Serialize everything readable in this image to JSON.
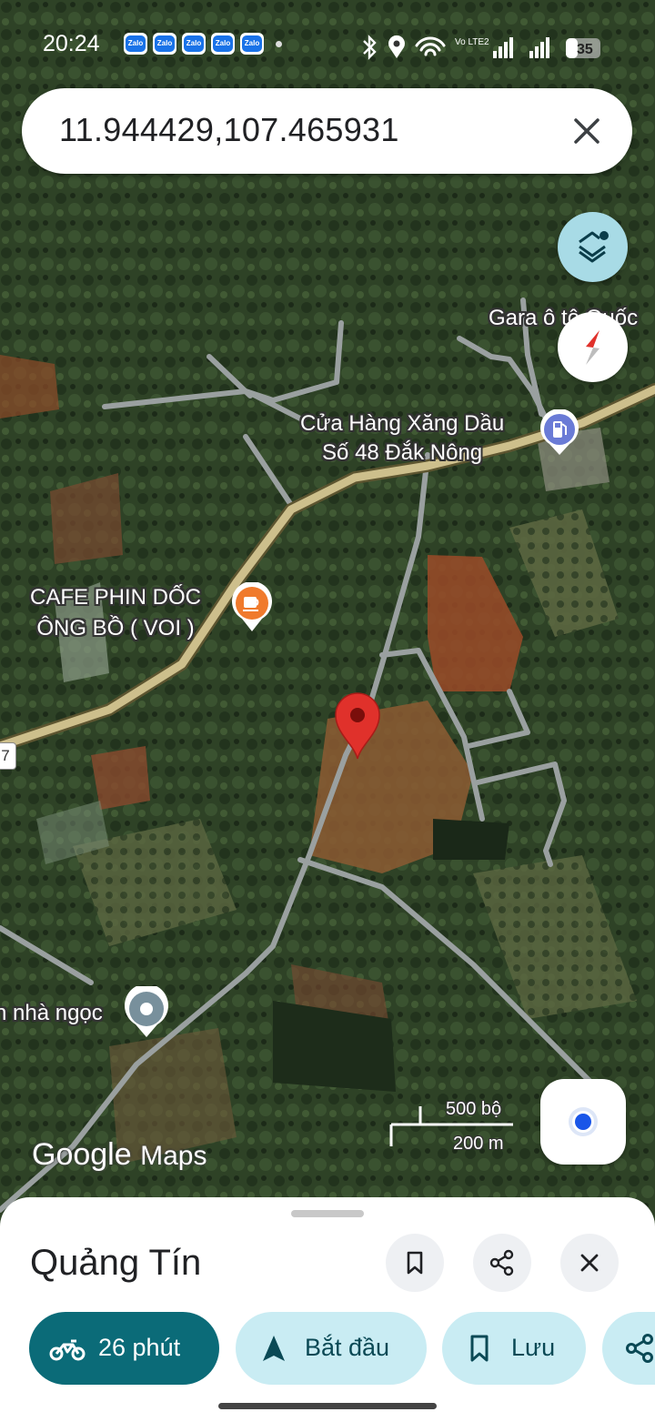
{
  "status_bar": {
    "time": "20:24",
    "notification_apps": [
      "Zalo",
      "Zalo",
      "Zalo",
      "Zalo",
      "Zalo"
    ],
    "network": "Vo LTE2",
    "battery": "35"
  },
  "search": {
    "query": "11.944429,107.465931"
  },
  "map": {
    "road_label": "7",
    "places": [
      {
        "name": "Gara ô tô Quốc",
        "icon": "none"
      },
      {
        "name_line1": "Cửa Hàng Xăng Dầu",
        "name_line2": "Số 48 Đắk Nông",
        "icon": "gas-station-icon"
      },
      {
        "name_line1": "CAFE PHIN DỐC",
        "name_line2": "ÔNG BỒ ( VOI )",
        "icon": "coffee-icon"
      },
      {
        "name": "n nhà ngọc",
        "icon": "place-pin-icon"
      }
    ],
    "scale": {
      "imperial": "500 bộ",
      "metric": "200 m"
    },
    "attribution": {
      "brand": "Google",
      "product": "Maps"
    }
  },
  "colors": {
    "accent_dark": "#0b6b78",
    "accent_light": "#c9ecf3",
    "pin_red": "#e0312b",
    "road_main": "#cdbf8c",
    "road_minor": "#9aa0a0"
  },
  "sheet": {
    "place_title": "Quảng Tín",
    "actions": [
      {
        "label": "26 phút",
        "icon": "motorbike-icon"
      },
      {
        "label": "Bắt đầu",
        "icon": "navigation-arrow-icon"
      },
      {
        "label": "Lưu",
        "icon": "bookmark-icon"
      },
      {
        "label": "",
        "icon": "share-icon"
      }
    ]
  }
}
